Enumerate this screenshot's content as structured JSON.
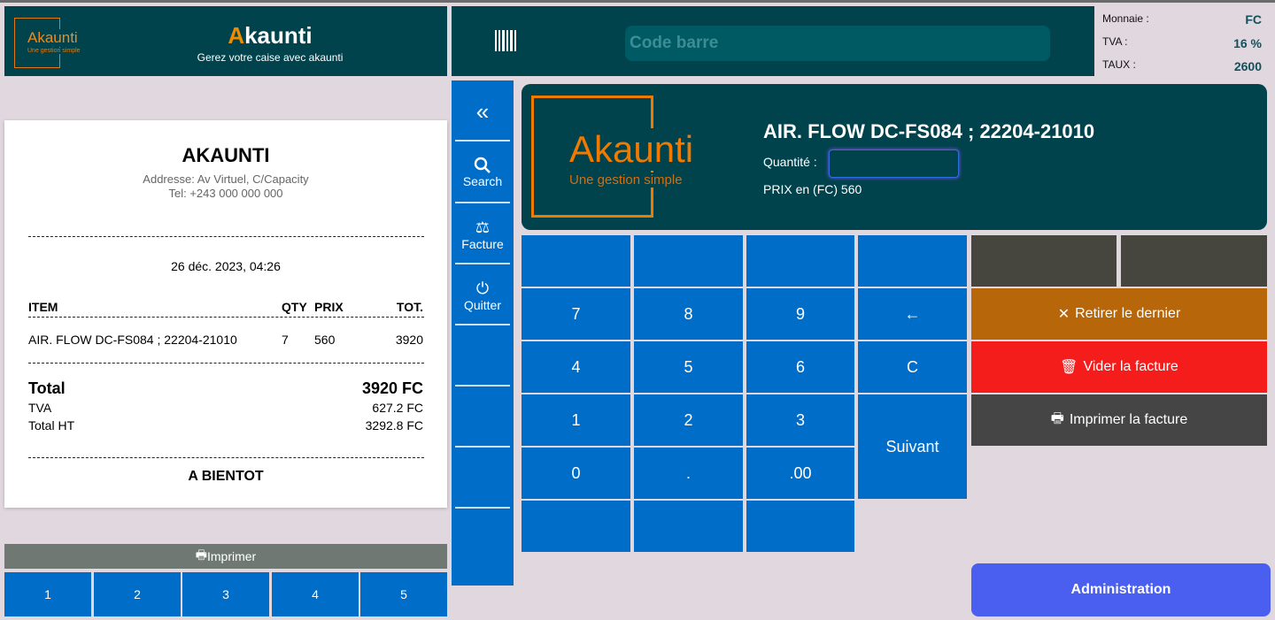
{
  "header": {
    "logo_text": "Akaunti",
    "logo_tagline": "Une gestion simple",
    "title_first": "A",
    "title_rest": "kaunti",
    "subtitle": "Gerez votre caise avec akaunti"
  },
  "barcode": {
    "placeholder": "Code barre"
  },
  "info": {
    "currency_label": "Monnaie :",
    "currency_value": "FC",
    "tva_label": "TVA :",
    "tva_value": "16 %",
    "rate_label": "TAUX :",
    "rate_value": "2600"
  },
  "receipt": {
    "company": "AKAUNTI",
    "address": "Addresse: Av Virtuel, C/Capacity",
    "phone": "Tel: +243 000 000 000",
    "date": "26 déc. 2023, 04:26",
    "headers": {
      "item": "ITEM",
      "qty": "QTY",
      "price": "PRIX",
      "total": "TOT."
    },
    "items": [
      {
        "name": "AIR. FLOW DC-FS084 ; 22204-21010",
        "qty": "7",
        "price": "560",
        "total": "3920"
      }
    ],
    "total_label": "Total",
    "total_value": "3920 FC",
    "tva_label": "TVA",
    "tva_value": "627.2 FC",
    "ht_label": "Total HT",
    "ht_value": "3292.8 FC",
    "footer": "A BIENTOT"
  },
  "print_button": "Imprimer",
  "tabs": [
    "1",
    "2",
    "3",
    "4",
    "5"
  ],
  "sidebar": {
    "collapse": "«",
    "search": "Search",
    "invoice": "Facture",
    "quit": "Quitter"
  },
  "product": {
    "name": "AIR. FLOW DC-FS084 ; 22204-21010",
    "qty_label": "Quantité :",
    "qty_value": "",
    "price_text": "PRIX en (FC) 560",
    "logo_text": "Akaunti",
    "logo_tagline": "Une gestion simple"
  },
  "keypad": {
    "k7": "7",
    "k8": "8",
    "k9": "9",
    "back": "←",
    "k4": "4",
    "k5": "5",
    "k6": "6",
    "clear": "C",
    "k1": "1",
    "k2": "2",
    "k3": "3",
    "next": "Suivant",
    "k0": "0",
    "dot": ".",
    "dzero": ".00"
  },
  "actions": {
    "remove_last": "Retirer le dernier",
    "clear_invoice": "Vider la facture",
    "print_invoice": "Imprimer la facture",
    "admin": "Administration"
  }
}
